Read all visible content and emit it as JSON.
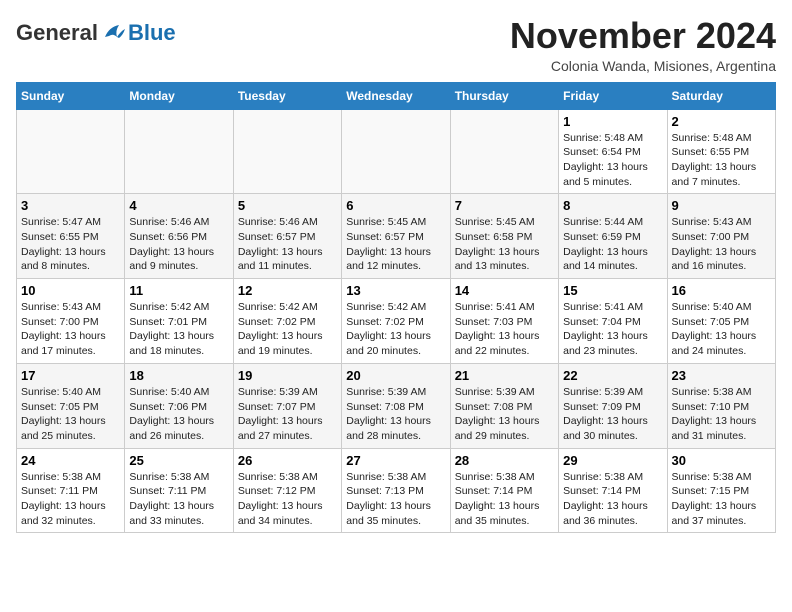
{
  "header": {
    "logo_general": "General",
    "logo_blue": "Blue",
    "month_title": "November 2024",
    "subtitle": "Colonia Wanda, Misiones, Argentina"
  },
  "days_of_week": [
    "Sunday",
    "Monday",
    "Tuesday",
    "Wednesday",
    "Thursday",
    "Friday",
    "Saturday"
  ],
  "weeks": [
    [
      {
        "day": "",
        "info": ""
      },
      {
        "day": "",
        "info": ""
      },
      {
        "day": "",
        "info": ""
      },
      {
        "day": "",
        "info": ""
      },
      {
        "day": "",
        "info": ""
      },
      {
        "day": "1",
        "info": "Sunrise: 5:48 AM\nSunset: 6:54 PM\nDaylight: 13 hours and 5 minutes."
      },
      {
        "day": "2",
        "info": "Sunrise: 5:48 AM\nSunset: 6:55 PM\nDaylight: 13 hours and 7 minutes."
      }
    ],
    [
      {
        "day": "3",
        "info": "Sunrise: 5:47 AM\nSunset: 6:55 PM\nDaylight: 13 hours and 8 minutes."
      },
      {
        "day": "4",
        "info": "Sunrise: 5:46 AM\nSunset: 6:56 PM\nDaylight: 13 hours and 9 minutes."
      },
      {
        "day": "5",
        "info": "Sunrise: 5:46 AM\nSunset: 6:57 PM\nDaylight: 13 hours and 11 minutes."
      },
      {
        "day": "6",
        "info": "Sunrise: 5:45 AM\nSunset: 6:57 PM\nDaylight: 13 hours and 12 minutes."
      },
      {
        "day": "7",
        "info": "Sunrise: 5:45 AM\nSunset: 6:58 PM\nDaylight: 13 hours and 13 minutes."
      },
      {
        "day": "8",
        "info": "Sunrise: 5:44 AM\nSunset: 6:59 PM\nDaylight: 13 hours and 14 minutes."
      },
      {
        "day": "9",
        "info": "Sunrise: 5:43 AM\nSunset: 7:00 PM\nDaylight: 13 hours and 16 minutes."
      }
    ],
    [
      {
        "day": "10",
        "info": "Sunrise: 5:43 AM\nSunset: 7:00 PM\nDaylight: 13 hours and 17 minutes."
      },
      {
        "day": "11",
        "info": "Sunrise: 5:42 AM\nSunset: 7:01 PM\nDaylight: 13 hours and 18 minutes."
      },
      {
        "day": "12",
        "info": "Sunrise: 5:42 AM\nSunset: 7:02 PM\nDaylight: 13 hours and 19 minutes."
      },
      {
        "day": "13",
        "info": "Sunrise: 5:42 AM\nSunset: 7:02 PM\nDaylight: 13 hours and 20 minutes."
      },
      {
        "day": "14",
        "info": "Sunrise: 5:41 AM\nSunset: 7:03 PM\nDaylight: 13 hours and 22 minutes."
      },
      {
        "day": "15",
        "info": "Sunrise: 5:41 AM\nSunset: 7:04 PM\nDaylight: 13 hours and 23 minutes."
      },
      {
        "day": "16",
        "info": "Sunrise: 5:40 AM\nSunset: 7:05 PM\nDaylight: 13 hours and 24 minutes."
      }
    ],
    [
      {
        "day": "17",
        "info": "Sunrise: 5:40 AM\nSunset: 7:05 PM\nDaylight: 13 hours and 25 minutes."
      },
      {
        "day": "18",
        "info": "Sunrise: 5:40 AM\nSunset: 7:06 PM\nDaylight: 13 hours and 26 minutes."
      },
      {
        "day": "19",
        "info": "Sunrise: 5:39 AM\nSunset: 7:07 PM\nDaylight: 13 hours and 27 minutes."
      },
      {
        "day": "20",
        "info": "Sunrise: 5:39 AM\nSunset: 7:08 PM\nDaylight: 13 hours and 28 minutes."
      },
      {
        "day": "21",
        "info": "Sunrise: 5:39 AM\nSunset: 7:08 PM\nDaylight: 13 hours and 29 minutes."
      },
      {
        "day": "22",
        "info": "Sunrise: 5:39 AM\nSunset: 7:09 PM\nDaylight: 13 hours and 30 minutes."
      },
      {
        "day": "23",
        "info": "Sunrise: 5:38 AM\nSunset: 7:10 PM\nDaylight: 13 hours and 31 minutes."
      }
    ],
    [
      {
        "day": "24",
        "info": "Sunrise: 5:38 AM\nSunset: 7:11 PM\nDaylight: 13 hours and 32 minutes."
      },
      {
        "day": "25",
        "info": "Sunrise: 5:38 AM\nSunset: 7:11 PM\nDaylight: 13 hours and 33 minutes."
      },
      {
        "day": "26",
        "info": "Sunrise: 5:38 AM\nSunset: 7:12 PM\nDaylight: 13 hours and 34 minutes."
      },
      {
        "day": "27",
        "info": "Sunrise: 5:38 AM\nSunset: 7:13 PM\nDaylight: 13 hours and 35 minutes."
      },
      {
        "day": "28",
        "info": "Sunrise: 5:38 AM\nSunset: 7:14 PM\nDaylight: 13 hours and 35 minutes."
      },
      {
        "day": "29",
        "info": "Sunrise: 5:38 AM\nSunset: 7:14 PM\nDaylight: 13 hours and 36 minutes."
      },
      {
        "day": "30",
        "info": "Sunrise: 5:38 AM\nSunset: 7:15 PM\nDaylight: 13 hours and 37 minutes."
      }
    ]
  ]
}
